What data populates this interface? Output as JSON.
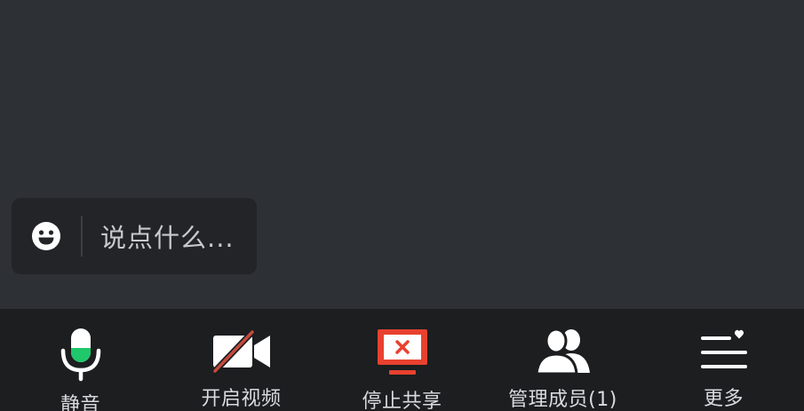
{
  "chat": {
    "placeholder": "说点什么...",
    "emoji_icon": "emoji-smile-icon"
  },
  "toolbar": {
    "items": [
      {
        "label": "静音",
        "icon": "microphone-icon"
      },
      {
        "label": "开启视频",
        "icon": "video-off-icon"
      },
      {
        "label": "停止共享",
        "icon": "stop-share-screen-icon"
      },
      {
        "label": "管理成员(1)",
        "icon": "members-icon"
      },
      {
        "label": "更多",
        "icon": "more-menu-icon"
      }
    ]
  },
  "colors": {
    "background": "#2d3034",
    "toolbar": "#1c1e20",
    "mic_active": "#1fc86a",
    "share_red": "#e8412f",
    "icon_white": "#ffffff"
  }
}
